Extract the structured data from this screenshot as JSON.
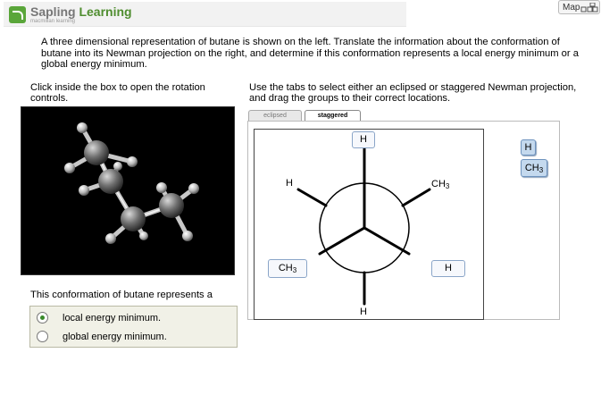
{
  "header": {
    "brand_main": "Sapling ",
    "brand_accent": "Learning",
    "brand_sub": "macmillan learning",
    "map_label": "Map"
  },
  "question": "A three dimensional representation of butane is shown on the left. Translate the information about the conformation of butane into its Newman projection on the right, and determine if this conformation represents a local energy minimum or a global energy minimum.",
  "left_instruction": "Click inside the box to open the rotation controls.",
  "right_instruction": "Use the tabs to select either an eclipsed or staggered Newman projection, and drag the groups to their correct locations.",
  "tabs": {
    "eclipsed": "eclipsed",
    "staggered": "staggered",
    "active": "staggered"
  },
  "newman": {
    "top_slot": "H",
    "bottom_left_slot": "CH",
    "bottom_right_slot": "H",
    "upper_left_label": "H",
    "upper_right_label": "CH",
    "bottom_label": "H",
    "subscript": "3"
  },
  "tray": {
    "item_h": "H",
    "item_ch3": "CH",
    "subscript": "3"
  },
  "answer_prompt": "This conformation of butane represents a",
  "options": [
    {
      "label": "local energy minimum.",
      "selected": true
    },
    {
      "label": "global energy minimum.",
      "selected": false
    }
  ],
  "colors": {
    "brand_green": "#4f8d2f",
    "tile_blue": "#c4d9ee",
    "answer_box": "#f1f1e7"
  }
}
